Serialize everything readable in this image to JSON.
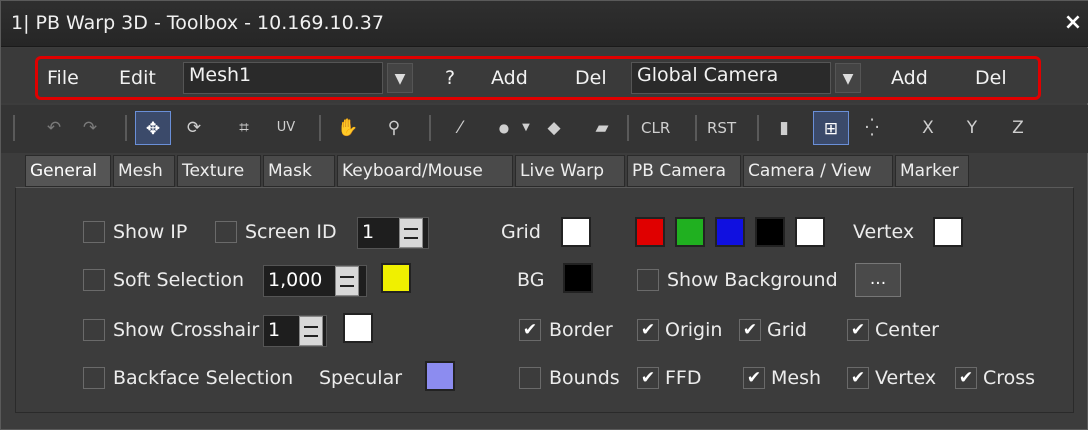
{
  "window": {
    "title": "1| PB Warp 3D - Toolbox - 10.169.10.37",
    "close": "×"
  },
  "menu": {
    "file": "File",
    "edit": "Edit",
    "mesh_combo": "Mesh1",
    "help": "?",
    "mesh_add": "Add",
    "mesh_del": "Del",
    "camera_combo": "Global Camera",
    "camera_add": "Add",
    "camera_del": "Del"
  },
  "toolbar": {
    "undo": "↶",
    "redo": "↷",
    "move": "✥",
    "rotate": "⟳",
    "scale": "⌗",
    "uv": "UV",
    "pan": "✋",
    "zoom": "⚲",
    "line": "⁄",
    "dot": "●",
    "fill": "◆",
    "eraser": "▰",
    "clr": "CLR",
    "rst": "RST",
    "cube": "▮",
    "grid": "⊞",
    "points": "⁛",
    "x": "X",
    "y": "Y",
    "z": "Z"
  },
  "tabs": [
    "General",
    "Mesh",
    "Texture",
    "Mask",
    "Keyboard/Mouse",
    "Live Warp",
    "PB Camera",
    "Camera / View",
    "Marker"
  ],
  "general": {
    "show_ip": {
      "label": "Show IP",
      "checked": false
    },
    "screen_id": {
      "label": "Screen ID",
      "checked": false,
      "value": "1"
    },
    "soft_selection": {
      "label": "Soft Selection",
      "checked": false,
      "value": "1,000"
    },
    "show_crosshair": {
      "label": "Show Crosshair",
      "checked": false,
      "value": "1"
    },
    "backface_selection": {
      "label": "Backface Selection",
      "checked": false
    },
    "specular": {
      "label": "Specular"
    },
    "grid": {
      "label": "Grid"
    },
    "bg": {
      "label": "BG"
    },
    "vertex": {
      "label": "Vertex"
    },
    "show_background": {
      "label": "Show Background",
      "checked": false,
      "button": "..."
    },
    "border": {
      "label": "Border",
      "checked": true
    },
    "origin": {
      "label": "Origin",
      "checked": true
    },
    "grid_cb": {
      "label": "Grid",
      "checked": true
    },
    "center": {
      "label": "Center",
      "checked": true
    },
    "bounds": {
      "label": "Bounds",
      "checked": false
    },
    "ffd": {
      "label": "FFD",
      "checked": true
    },
    "mesh": {
      "label": "Mesh",
      "checked": true
    },
    "vertex_cb": {
      "label": "Vertex",
      "checked": true
    },
    "cross": {
      "label": "Cross",
      "checked": true
    }
  },
  "colors": {
    "soft_selection": "#f0f000",
    "crosshair": "#ffffff",
    "specular": "#8c8cf0",
    "grid": "#ffffff",
    "bg": "#000000",
    "vertex": "#ffffff",
    "palette": [
      "#e00000",
      "#20b020",
      "#1010e0",
      "#000000",
      "#ffffff"
    ],
    "accent": "#e00000"
  }
}
